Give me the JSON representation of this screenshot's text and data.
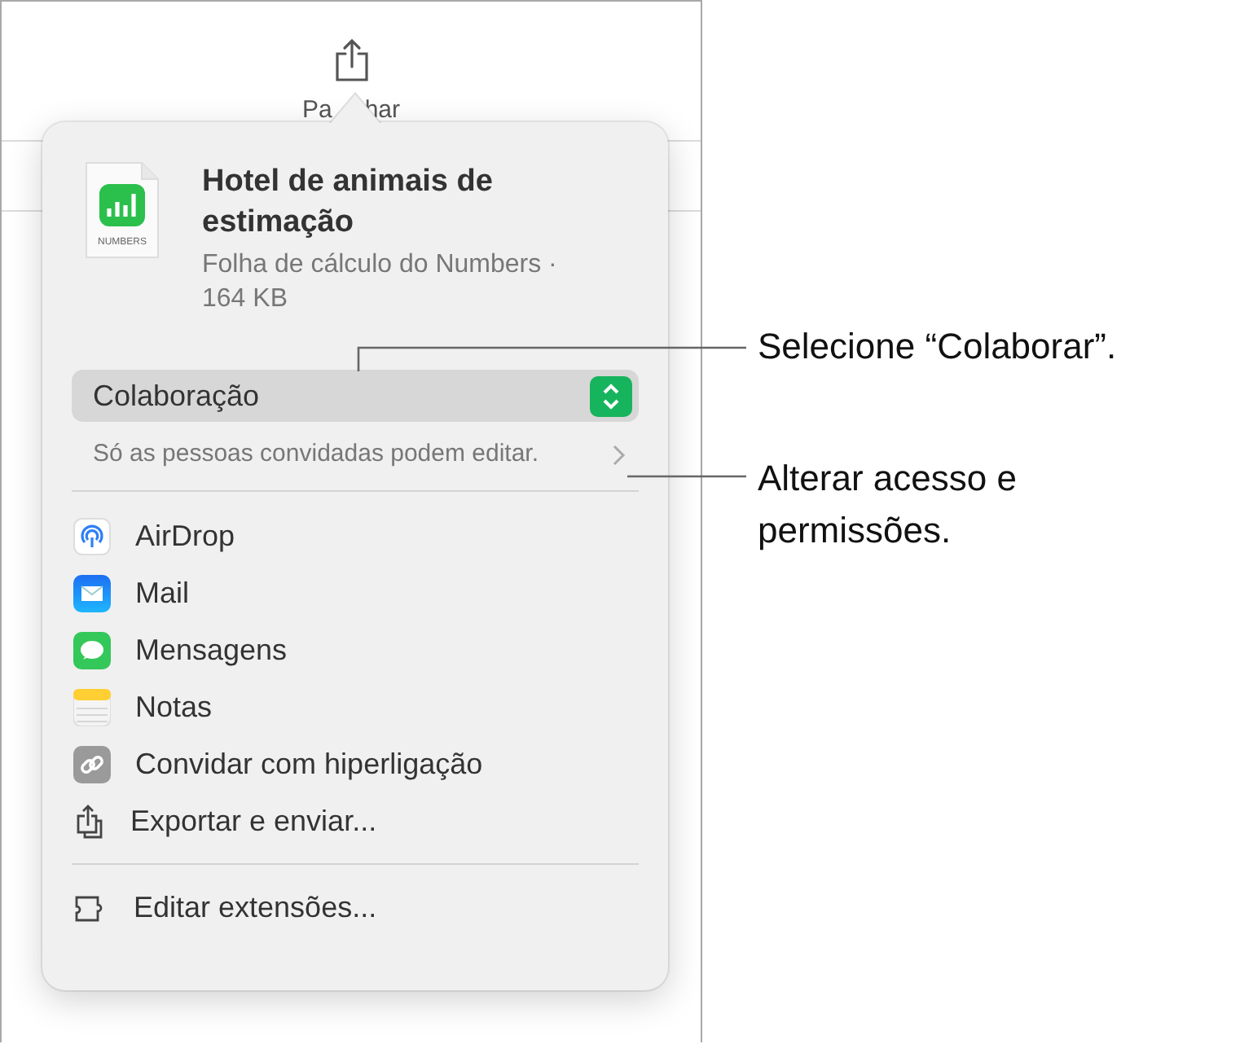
{
  "toolbar": {
    "label_parts": [
      "Pa",
      "har"
    ]
  },
  "share_popover": {
    "file": {
      "title": "Hotel de animais de estimação",
      "subtitle": "Folha de cálculo do Numbers · 164 KB",
      "icon_caption": "NUMBERS"
    },
    "mode_dropdown": {
      "value": "Colaboração"
    },
    "access_summary": "Só as pessoas convidadas podem editar.",
    "items": [
      {
        "label": "AirDrop",
        "kind": "airdrop"
      },
      {
        "label": "Mail",
        "kind": "mail"
      },
      {
        "label": "Mensagens",
        "kind": "messages"
      },
      {
        "label": "Notas",
        "kind": "notes"
      },
      {
        "label": "Convidar com hiperligação",
        "kind": "link"
      },
      {
        "label": "Exportar e enviar...",
        "kind": "export"
      }
    ],
    "footer_item": {
      "label": "Editar extensões...",
      "kind": "extensions"
    }
  },
  "callouts": [
    {
      "text": "Selecione “Colaborar”."
    },
    {
      "text": "Alterar acesso e permissões."
    }
  ]
}
